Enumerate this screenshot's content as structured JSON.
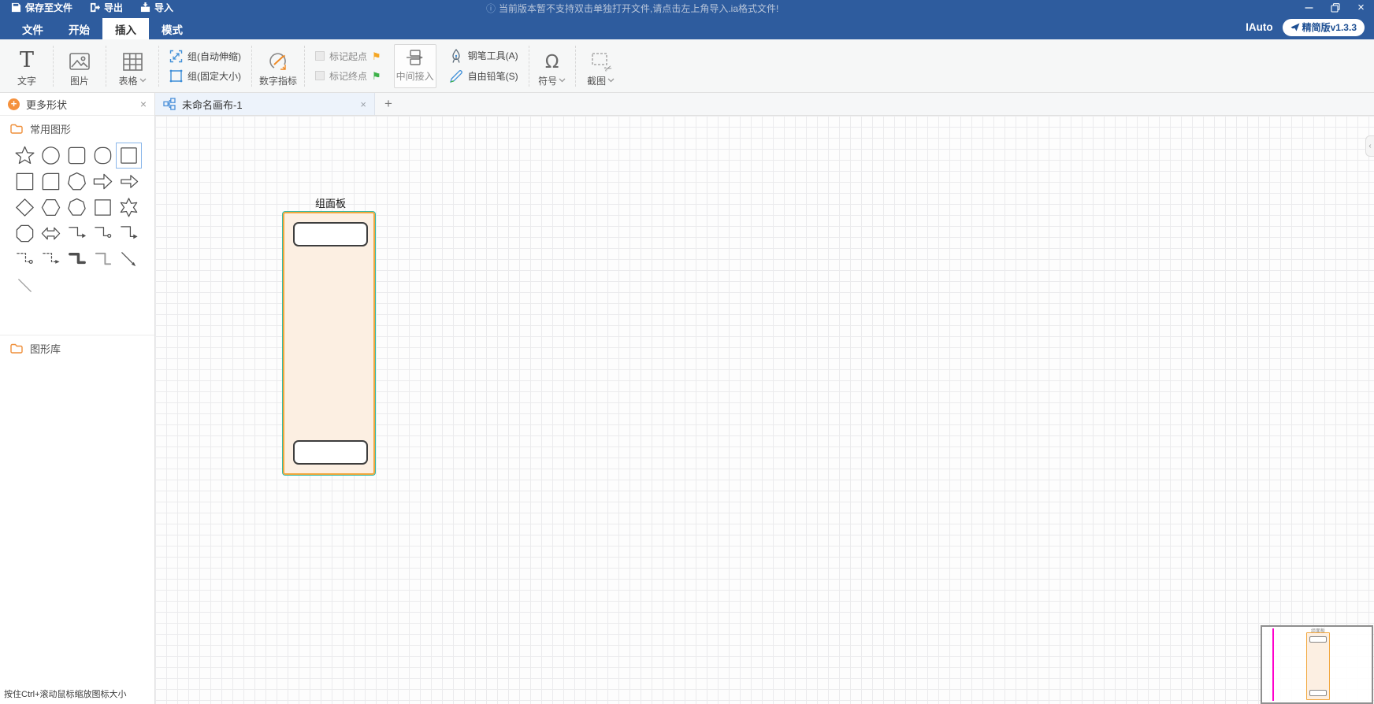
{
  "titlebar": {
    "save_label": "保存至文件",
    "export_label": "导出",
    "import_label": "导入",
    "notice": "当前版本暂不支持双击单独打开文件,请点击左上角导入.ia格式文件!"
  },
  "menubar": {
    "tabs": [
      {
        "label": "文件"
      },
      {
        "label": "开始"
      },
      {
        "label": "插入"
      },
      {
        "label": "模式"
      }
    ],
    "active_tab": "插入",
    "brand": "IAuto",
    "version_badge": "精简版v1.3.3"
  },
  "ribbon": {
    "text": "文字",
    "image": "图片",
    "table": "表格",
    "group_auto": "组(自动伸缩)",
    "group_fixed": "组(固定大小)",
    "numeric_indicator": "数字指标",
    "mark_start": "标记起点",
    "mark_end": "标记终点",
    "middle_insert": "中间接入",
    "pen_tool": "钢笔工具(A)",
    "free_pencil": "自由铅笔(S)",
    "symbol": "符号",
    "screenshot": "截图"
  },
  "sidebar": {
    "header": "更多形状",
    "section_common": "常用图形",
    "section_library": "图形库",
    "selected_index": 4,
    "shapes": [
      "star-5",
      "circle",
      "square-rounded",
      "squircle",
      "square-selected",
      "square",
      "square-corner",
      "heptagon",
      "arrow-right",
      "arrow-right-thin",
      "diamond",
      "hexagon",
      "heptagon-2",
      "square-2",
      "star-6",
      "octagon",
      "arrow-double-h",
      "elbow-arrow",
      "elbow-circle",
      "elbow-arrow-2",
      "elbow-dashed-circle",
      "elbow-dashed-arrow",
      "elbow-thick",
      "elbow-line",
      "line-arrow-diag",
      "line-diag"
    ]
  },
  "tabbar": {
    "tab_title": "未命名画布-1"
  },
  "canvas": {
    "panel_label": "组面板",
    "minimap_label": "组面板"
  },
  "statusbar": {
    "zoom_hint": "按住Ctrl+滚动鼠标缩放图标大小"
  },
  "icons": {
    "close": "×",
    "plus": "+",
    "flag": "⚑",
    "omega": "Ω",
    "collapse": "‹",
    "info": "ⓘ",
    "text_tool": "T",
    "scissors": "✂"
  },
  "colors": {
    "titlebar_bg": "#2e5c9e",
    "accent_blue": "#3f8fd8",
    "brand_orange": "#f5913d",
    "flag_start": "#f5a623",
    "flag_end": "#3eb24a",
    "panel_fill": "#fcefe2",
    "panel_border": "#f2a73d",
    "selection_teal": "#35b9a5",
    "minimap_line": "#ff00cc",
    "tab_active_bg": "#edf3fb"
  }
}
